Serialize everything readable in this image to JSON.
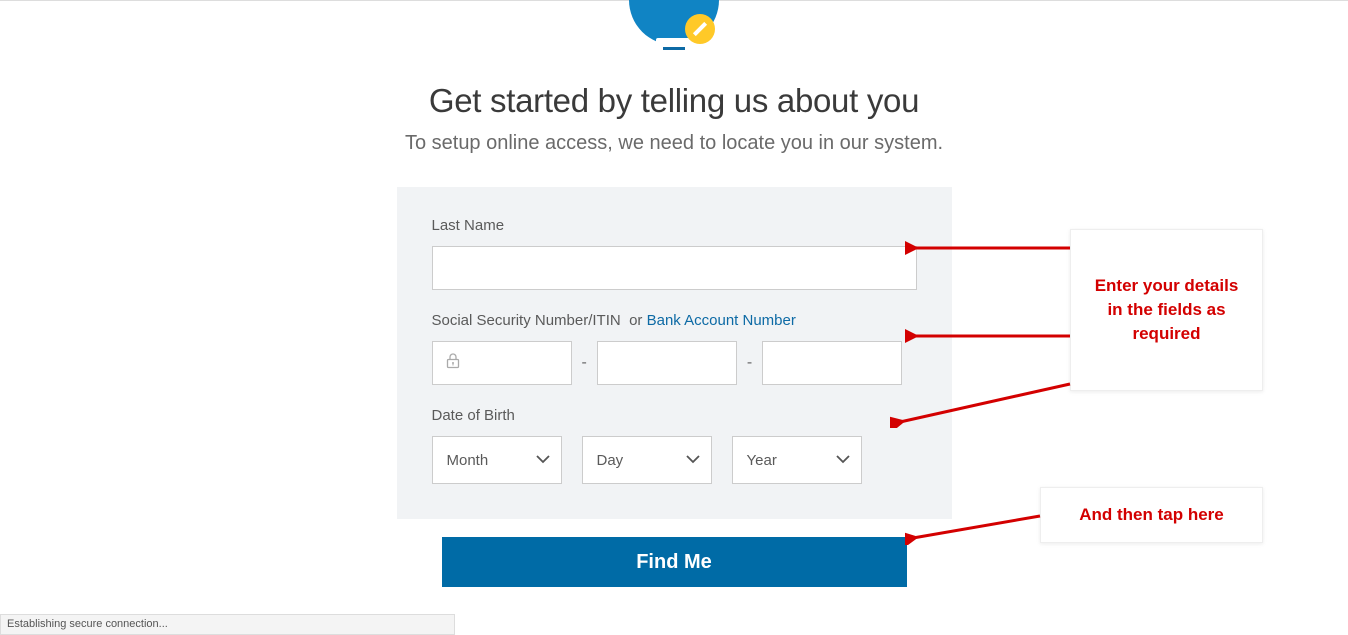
{
  "header_icon": {
    "type": "clipboard-with-pencil",
    "circle_color": "#1084c4",
    "pencil_circle_color": "#ffc928"
  },
  "heading": "Get started by telling us about you",
  "subheading": "To setup online access, we need to locate you in our system.",
  "form": {
    "last_name_label": "Last Name",
    "last_name_value": "",
    "ssn_label": "Social Security Number/ITIN",
    "or_text": "or",
    "bank_link": "Bank Account Number",
    "ssn_value_1": "",
    "ssn_value_2": "",
    "ssn_value_3": "",
    "dash": "-",
    "dob_label": "Date of Birth",
    "month_label": "Month",
    "day_label": "Day",
    "year_label": "Year",
    "submit_label": "Find Me"
  },
  "annotations": {
    "details": "Enter your details in the fields as required",
    "tap": "And then tap here"
  },
  "status": "Establishing secure connection...",
  "colors": {
    "primary_button": "#006ba6",
    "link": "#0d6aa5",
    "annotation": "#d30000",
    "form_bg": "#f1f3f5"
  }
}
